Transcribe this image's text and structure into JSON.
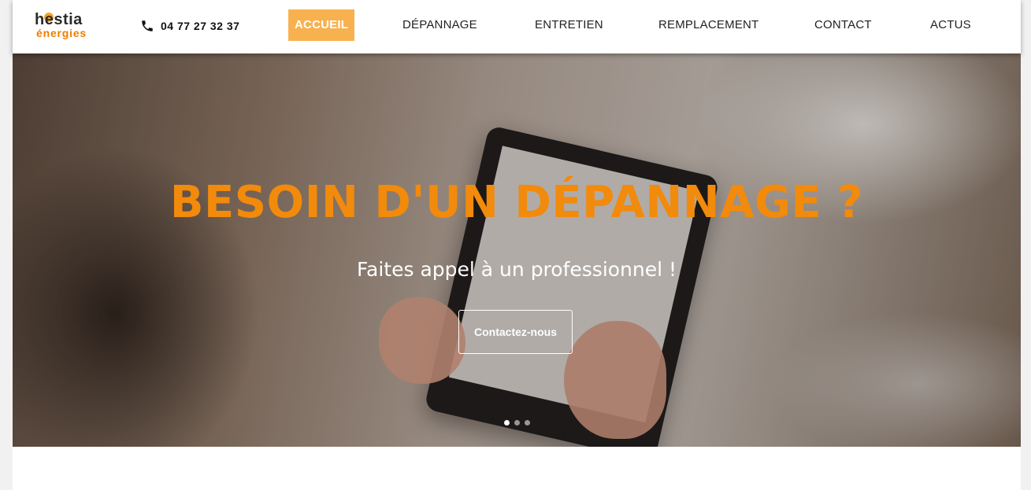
{
  "brand": {
    "line1": "hestia",
    "line2": "énergies"
  },
  "phone": {
    "icon": "phone-icon",
    "number": "04 77 27 32 37"
  },
  "nav": {
    "items": [
      {
        "label": "ACCUEIL"
      },
      {
        "label": "DÉPANNAGE"
      },
      {
        "label": "ENTRETIEN"
      },
      {
        "label": "REMPLACEMENT"
      },
      {
        "label": "CONTACT"
      },
      {
        "label": "ACTUS"
      }
    ],
    "active_index": 0,
    "active_color": "#f8b14f"
  },
  "hero": {
    "title": "BESOIN D'UN DÉPANNAGE ?",
    "subtitle": "Faites appel à un professionnel !",
    "cta_label": "Contactez-nous",
    "title_color": "#f28a0c",
    "slides_count": 3,
    "active_slide": 1
  }
}
